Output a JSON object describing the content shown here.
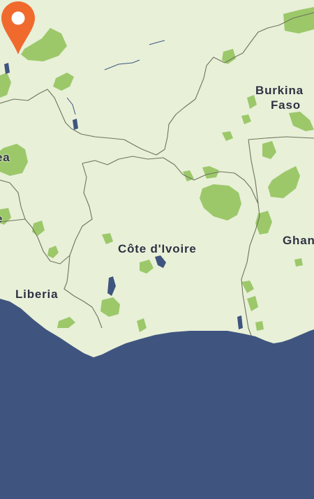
{
  "map": {
    "colors": {
      "land": "#e8f0d8",
      "water": "#3f557f",
      "vegetation": "#9cc86a",
      "border": "#6f745e",
      "label": "#2d3340",
      "pin": "#f06a2d"
    },
    "labels": {
      "burkina_line1": "Burkina",
      "burkina_line2": "Faso",
      "cote_divoire": "Côte d'Ivoire",
      "liberia": "Liberia",
      "ghana": "Ghan",
      "guinea": "ea",
      "sierra_leone": "e"
    },
    "marker": {
      "icon": "location-pin-icon",
      "color": "#f06a2d"
    }
  }
}
